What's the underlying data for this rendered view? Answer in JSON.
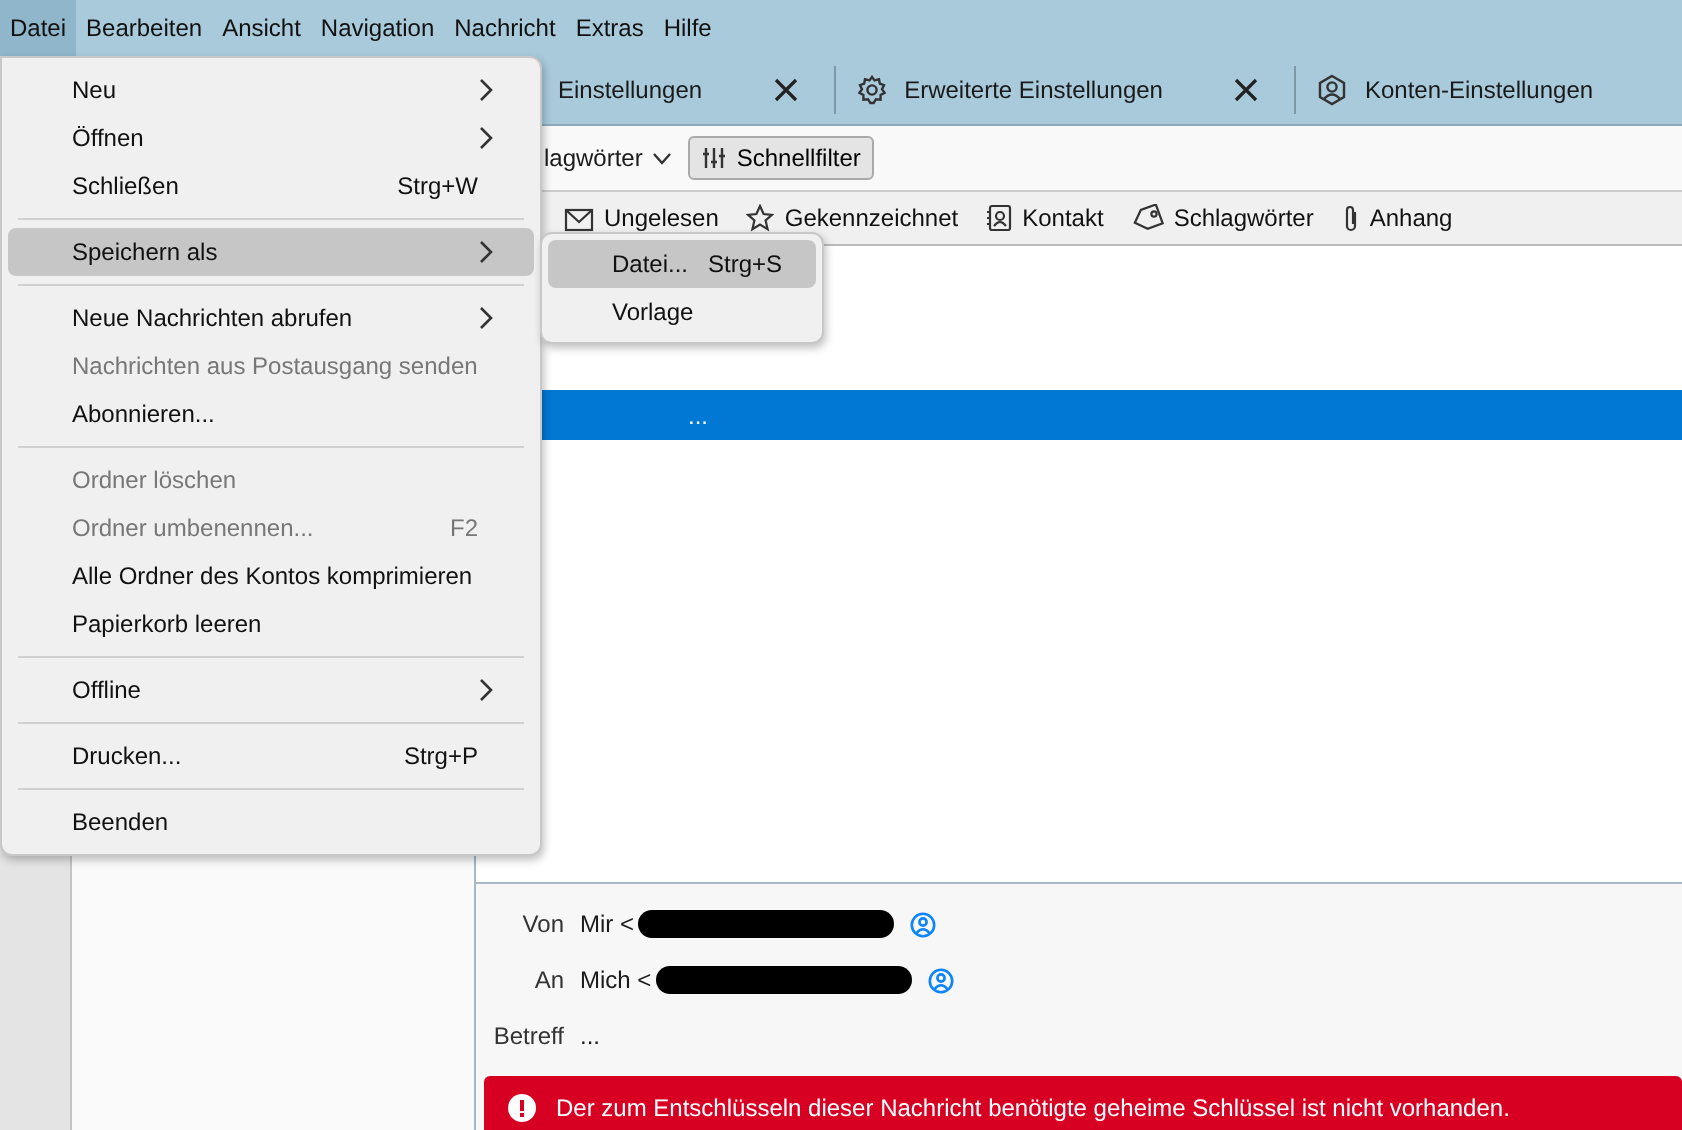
{
  "menubar": [
    {
      "label": "Datei",
      "selected": true
    },
    {
      "label": "Bearbeiten",
      "selected": false
    },
    {
      "label": "Ansicht",
      "selected": false
    },
    {
      "label": "Navigation",
      "selected": false
    },
    {
      "label": "Nachricht",
      "selected": false
    },
    {
      "label": "Extras",
      "selected": false
    },
    {
      "label": "Hilfe",
      "selected": false
    }
  ],
  "file_menu": [
    {
      "kind": "item",
      "label": "Neu",
      "submenu": true,
      "disabled": false,
      "selected": false
    },
    {
      "kind": "item",
      "label": "Öffnen",
      "submenu": true,
      "disabled": false,
      "selected": false
    },
    {
      "kind": "item",
      "label": "Schließen",
      "shortcut": "Strg+W",
      "submenu": false,
      "disabled": false,
      "selected": false
    },
    {
      "kind": "separator"
    },
    {
      "kind": "item",
      "label": "Speichern als",
      "submenu": true,
      "disabled": false,
      "selected": true
    },
    {
      "kind": "separator"
    },
    {
      "kind": "item",
      "label": "Neue Nachrichten abrufen",
      "submenu": true,
      "disabled": false,
      "selected": false
    },
    {
      "kind": "item",
      "label": "Nachrichten aus Postausgang senden",
      "submenu": false,
      "disabled": true,
      "selected": false
    },
    {
      "kind": "item",
      "label": "Abonnieren...",
      "submenu": false,
      "disabled": false,
      "selected": false
    },
    {
      "kind": "separator"
    },
    {
      "kind": "item",
      "label": "Ordner löschen",
      "submenu": false,
      "disabled": true,
      "selected": false
    },
    {
      "kind": "item",
      "label": "Ordner umbenennen...",
      "shortcut": "F2",
      "submenu": false,
      "disabled": true,
      "selected": false
    },
    {
      "kind": "item",
      "label": "Alle Ordner des Kontos komprimieren",
      "submenu": false,
      "disabled": false,
      "selected": false
    },
    {
      "kind": "item",
      "label": "Papierkorb leeren",
      "submenu": false,
      "disabled": false,
      "selected": false
    },
    {
      "kind": "separator"
    },
    {
      "kind": "item",
      "label": "Offline",
      "submenu": true,
      "disabled": false,
      "selected": false
    },
    {
      "kind": "separator"
    },
    {
      "kind": "item",
      "label": "Drucken...",
      "shortcut": "Strg+P",
      "submenu": false,
      "disabled": false,
      "selected": false
    },
    {
      "kind": "separator"
    },
    {
      "kind": "item",
      "label": "Beenden",
      "submenu": false,
      "disabled": false,
      "selected": false
    }
  ],
  "save_as_submenu": [
    {
      "label": "Datei...",
      "shortcut": "Strg+S",
      "selected": true
    },
    {
      "label": "Vorlage",
      "selected": false
    }
  ],
  "tabs": [
    {
      "kind": "plain",
      "label": "Einstellungen",
      "closable": true
    },
    {
      "kind": "gear",
      "label": "Erweiterte Einstellungen",
      "closable": true
    },
    {
      "kind": "account",
      "label": "Konten-Einstellungen",
      "closable": false
    }
  ],
  "toolbar": {
    "tags_dropdown": "lagwörter",
    "quick_filter": "Schnellfilter"
  },
  "filters": [
    {
      "kind": "unread",
      "label": "Ungelesen"
    },
    {
      "kind": "star",
      "label": "Gekennzeichnet"
    },
    {
      "kind": "contact",
      "label": "Kontakt"
    },
    {
      "kind": "tag",
      "label": "Schlagwörter"
    },
    {
      "kind": "attachment",
      "label": "Anhang"
    }
  ],
  "message_list": [
    {
      "subject": "...",
      "selected": true
    }
  ],
  "header": {
    "fields": [
      {
        "label": "Von",
        "value": "Mir <",
        "redacted": true,
        "contact_icon": true
      },
      {
        "label": "An",
        "value": "Mich <",
        "redacted": true,
        "contact_icon": true
      },
      {
        "label": "Betreff",
        "value": "...",
        "redacted": false,
        "contact_icon": false
      }
    ]
  },
  "notification": {
    "kind": "error",
    "text": "Der zum Entschlüsseln dieser Nachricht benötigte geheime Schlüssel ist nicht vorhanden."
  }
}
